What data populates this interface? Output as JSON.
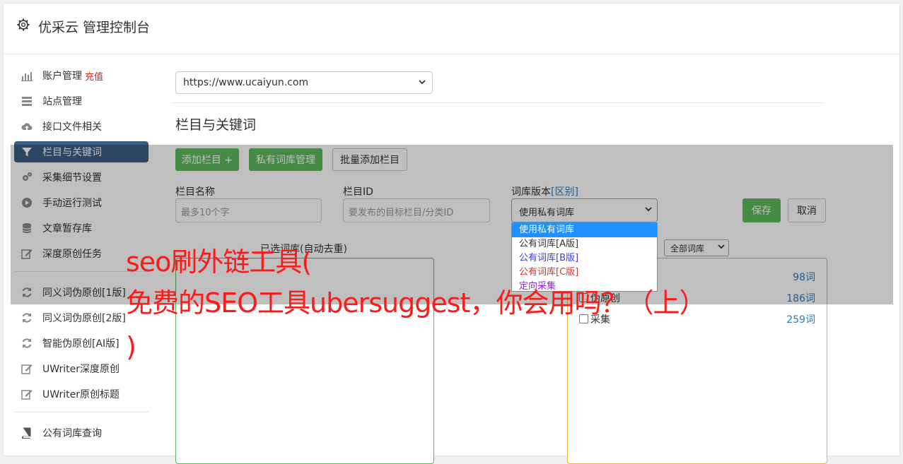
{
  "header": {
    "title": "优采云 管理控制台"
  },
  "sidebar": {
    "items": [
      {
        "label": "账户管理",
        "extra": "充值"
      },
      {
        "label": "站点管理"
      },
      {
        "label": "接口文件相关"
      },
      {
        "label": "栏目与关键词"
      },
      {
        "label": "采集细节设置"
      },
      {
        "label": "手动运行测试"
      },
      {
        "label": "文章暂存库"
      },
      {
        "label": "深度原创任务"
      },
      {
        "label": "同义词伪原创[1版]"
      },
      {
        "label": "同义词伪原创[2版]"
      },
      {
        "label": "智能伪原创[AI版]"
      },
      {
        "label": "UWriter深度原创"
      },
      {
        "label": "UWriter原创标题"
      },
      {
        "label": "公有词库查询"
      }
    ]
  },
  "main": {
    "site_select": "https://www.ucaiyun.com",
    "section_title": "栏目与关键词",
    "buttons": {
      "add_column": "添加栏目 +",
      "private_lib": "私有词库管理",
      "batch_add": "批量添加栏目",
      "save": "保存",
      "cancel": "取消"
    },
    "form": {
      "name_label": "栏目名称",
      "name_placeholder": "最多10个字",
      "id_label": "栏目ID",
      "id_placeholder": "要发布的目标栏目/分类ID",
      "version_label": "词库版本",
      "version_label_link": "[区别]",
      "version_value": "使用私有词库"
    },
    "dropdown_options": [
      {
        "label": "使用私有词库",
        "color": "#ffffff"
      },
      {
        "label": "公有词库[A版]",
        "color": "#333333"
      },
      {
        "label": "公有词库[B版]",
        "color": "#3c3cd8"
      },
      {
        "label": "公有词库[C版]",
        "color": "#c23b3b"
      },
      {
        "label": "定向采集",
        "color": "#8b2ad6"
      }
    ],
    "selected_panel_title": "已选词库(自动去重)",
    "all_lib_select": "全部词库",
    "lib_rows": [
      {
        "name": "",
        "count": "98词"
      },
      {
        "name": "伪原创",
        "count": "186词"
      },
      {
        "name": "采集",
        "count": "259词"
      }
    ]
  },
  "watermark": {
    "line1": "seo刷外链工具(",
    "line2": "免费的SEO工具ubersuggest，你会用吗？（上）",
    "line3": ")"
  },
  "colors": {
    "accent_green": "#5cb85c",
    "active_nav": "#3d5e82",
    "watermark": "#ff1a1a"
  }
}
